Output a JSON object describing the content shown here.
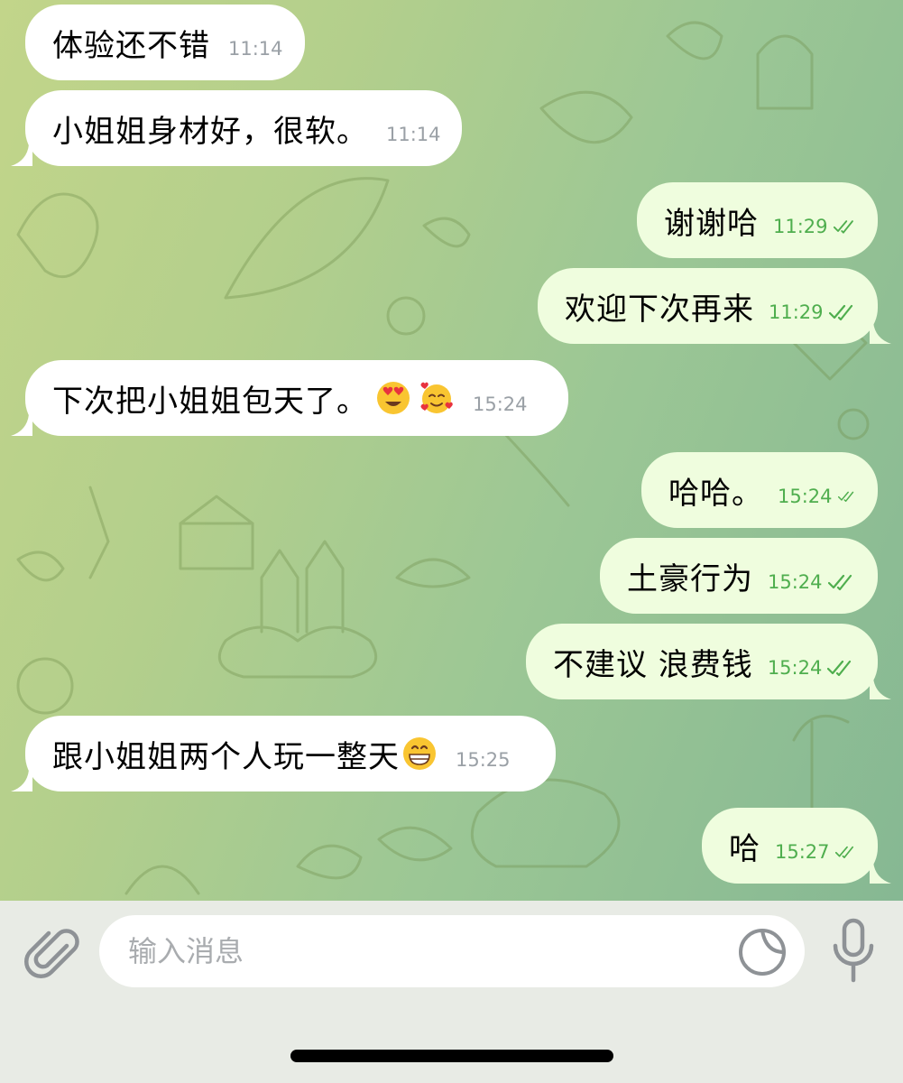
{
  "messages": [
    {
      "dir": "in",
      "text": "体验还不错",
      "time": "11:14"
    },
    {
      "dir": "in",
      "text": "小姐姐身材好，很软。",
      "time": "11:14"
    },
    {
      "dir": "out",
      "text": "谢谢哈",
      "time": "11:29"
    },
    {
      "dir": "out",
      "text": "欢迎下次再来",
      "time": "11:29"
    },
    {
      "dir": "in",
      "text": "下次把小姐姐包天了。",
      "time": "15:24",
      "emojis": [
        "heart-eyes-emoji",
        "smiling-face-with-hearts-emoji"
      ]
    },
    {
      "dir": "out",
      "text": "哈哈。",
      "time": "15:24"
    },
    {
      "dir": "out",
      "text": "土豪行为",
      "time": "15:24"
    },
    {
      "dir": "out",
      "text": "不建议 浪费钱",
      "time": "15:24"
    },
    {
      "dir": "in",
      "text": "跟小姐姐两个人玩一整天",
      "time": "15:25",
      "emojis": [
        "grinning-face-emoji"
      ]
    },
    {
      "dir": "out",
      "text": "哈",
      "time": "15:27"
    }
  ],
  "composer": {
    "placeholder": "输入消息",
    "attach_icon": "paperclip-icon",
    "sticker_icon": "sticker-icon",
    "mic_icon": "microphone-icon"
  },
  "colors": {
    "incoming_bubble": "#ffffff",
    "outgoing_bubble": "#effdde",
    "outgoing_time": "#4fae4e",
    "incoming_time": "#9aa0a6",
    "input_bar": "#e8ebe5"
  }
}
